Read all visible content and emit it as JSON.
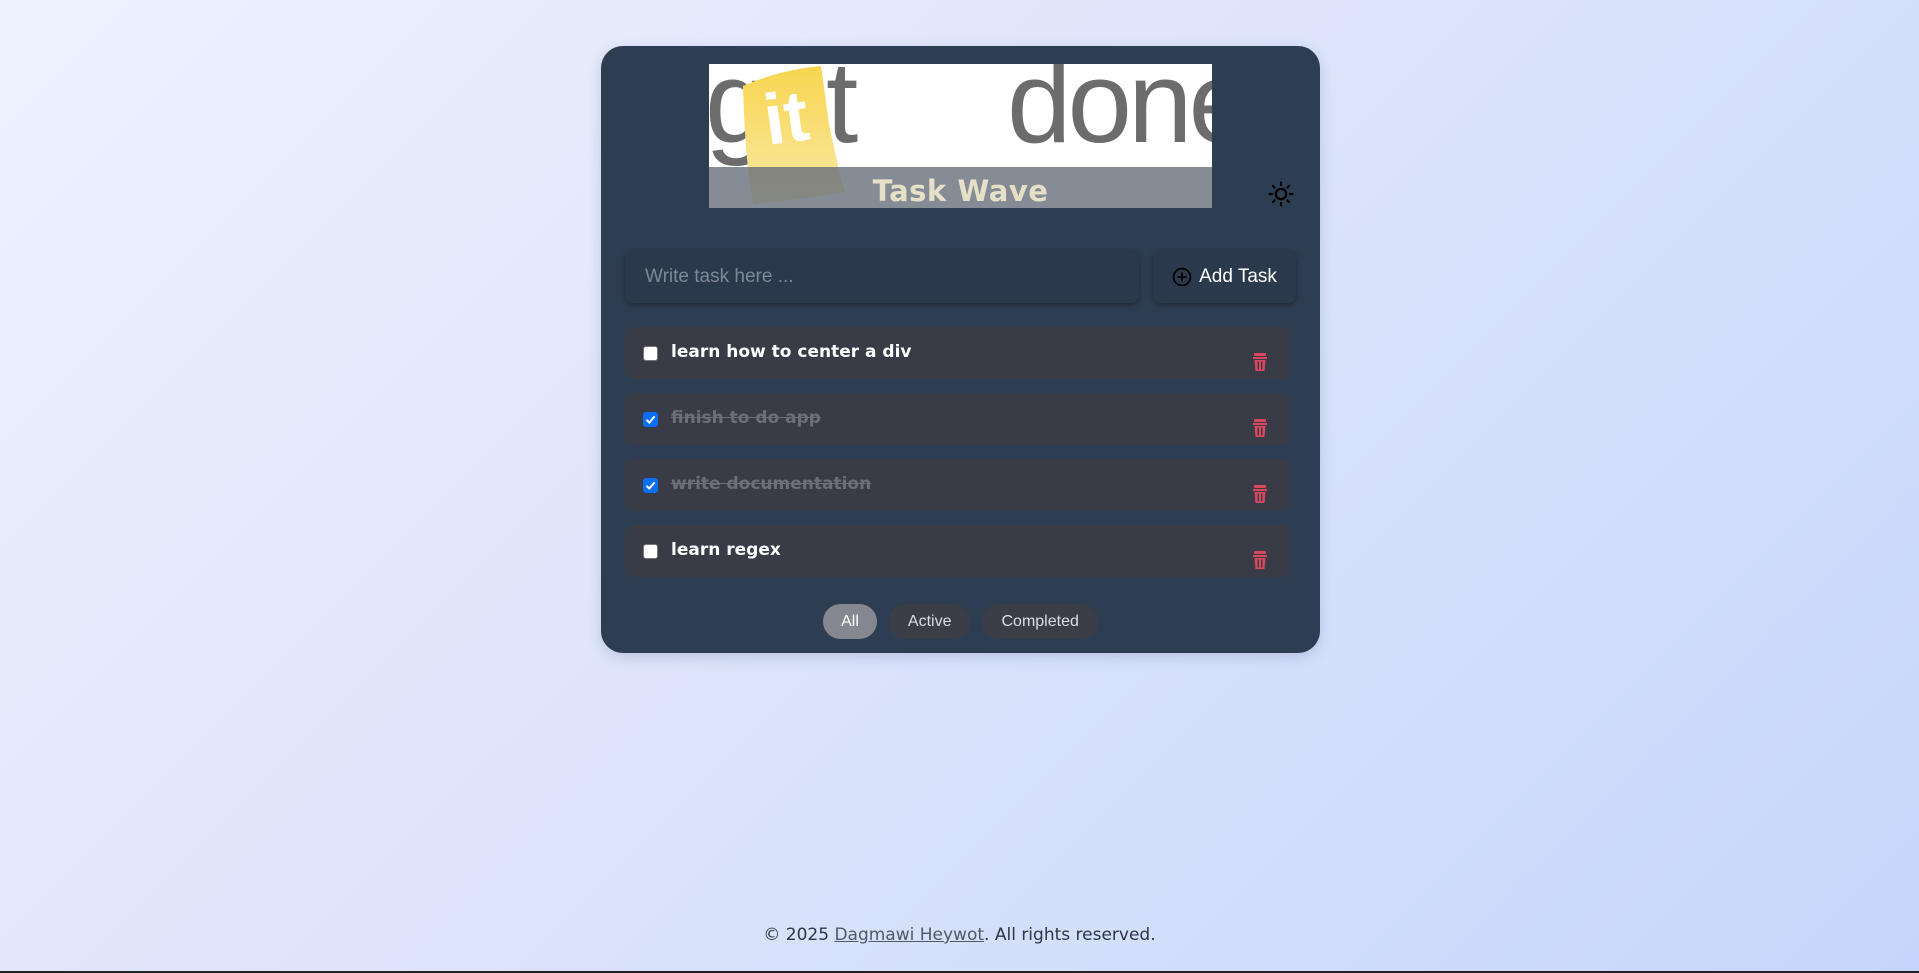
{
  "app": {
    "logo": {
      "wordmark_left": "get",
      "wordmark_mid": "it",
      "wordmark_right": "done",
      "title": "Task Wave"
    },
    "theme_toggle_icon": "sun-icon"
  },
  "new_task": {
    "placeholder": "Write task here ...",
    "value": "",
    "add_label": "Add Task",
    "add_icon": "plus-circle-icon"
  },
  "tasks": [
    {
      "text": "learn how to center a div",
      "completed": false
    },
    {
      "text": "finish to do app",
      "completed": true
    },
    {
      "text": "write documentation",
      "completed": true
    },
    {
      "text": "learn regex",
      "completed": false
    }
  ],
  "filters": {
    "all": "All",
    "active": "Active",
    "completed": "Completed",
    "selected": "All"
  },
  "footer": {
    "prefix": "© 2025 ",
    "author": "Dagmawi Heywot",
    "suffix": ". All rights reserved."
  },
  "colors": {
    "card_bg": "#2e3e52",
    "task_bg": "#393b46",
    "checkbox_checked": "#0b6ff5",
    "delete_icon": "#d9485f",
    "logo_accent": "#f5d451"
  }
}
